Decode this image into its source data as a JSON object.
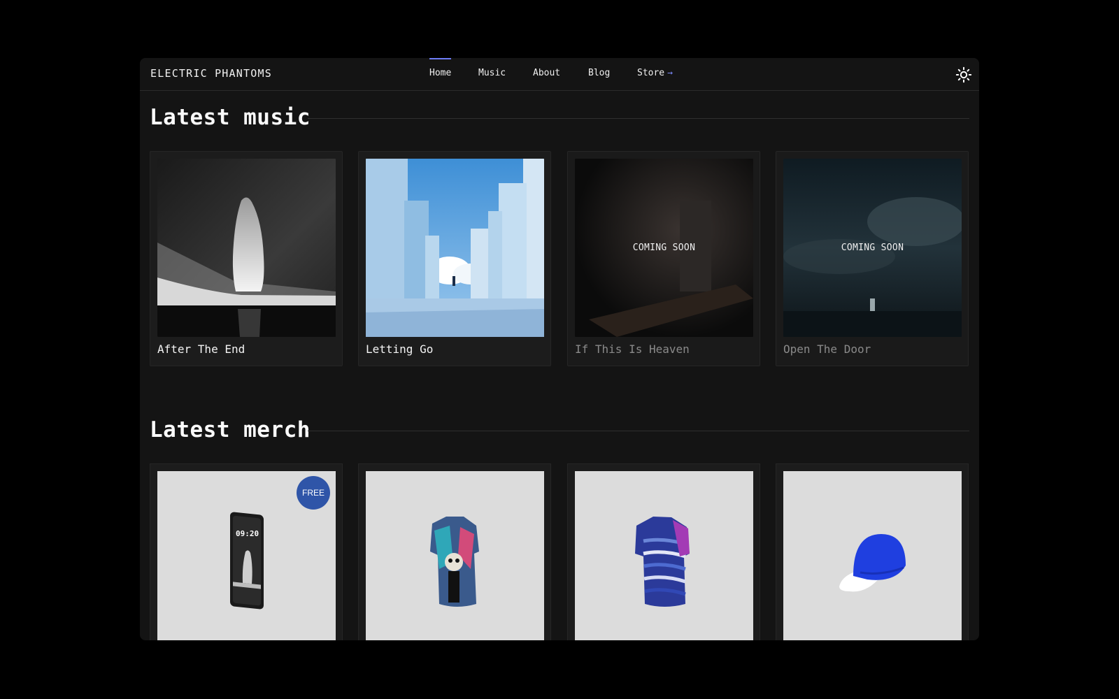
{
  "app": {
    "brand": "ELECTRIC PHANTOMS"
  },
  "nav": {
    "links": [
      "Home",
      "Music",
      "About",
      "Blog",
      "Store"
    ],
    "active": "Home",
    "store_arrow": "→",
    "theme_icon": "sun-icon"
  },
  "colors": {
    "accent": "#6d7cf6",
    "background": "#141414",
    "card": "#1c1c1c",
    "badge": "#2f55a8"
  },
  "music": {
    "title": "Latest music",
    "items": [
      {
        "title": "After The End",
        "status": ""
      },
      {
        "title": "Letting Go",
        "status": ""
      },
      {
        "title": "If This Is Heaven",
        "status": "COMING SOON"
      },
      {
        "title": "Open The Door",
        "status": "COMING SOON"
      }
    ]
  },
  "merch": {
    "title": "Latest merch",
    "items": [
      {
        "badge": "FREE",
        "product": "phone-wallpaper",
        "screen_time": "09:20"
      },
      {
        "badge": "",
        "product": "t-shirt-skull"
      },
      {
        "badge": "",
        "product": "t-shirt-stripes"
      },
      {
        "badge": "",
        "product": "cap-blue"
      }
    ]
  }
}
